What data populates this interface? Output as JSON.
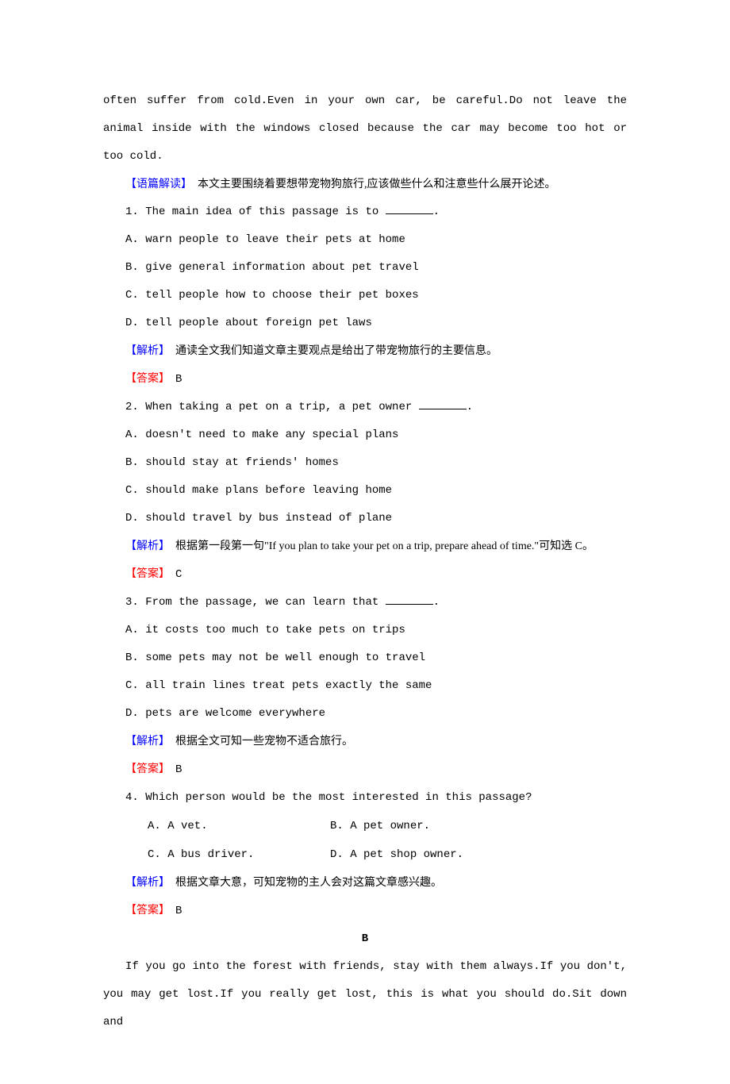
{
  "p1": "often suffer from cold.Even in your own car, be careful.Do not leave the animal inside with the windows closed because the car may become too hot or too cold.",
  "langHead": {
    "label": "【语篇解读】",
    "text": "　本文主要围绕着要想带宠物狗旅行,应该做些什么和注意些什么展开论述。"
  },
  "q1": {
    "stem": "1. The main idea of this passage is to ",
    "stemEnd": ".",
    "a": "A. warn people to leave their pets at home",
    "b": "B. give general information about pet travel",
    "c": "C. tell people how to choose their pet boxes",
    "d": "D. tell people about foreign pet laws",
    "expLabel": "【解析】",
    "expText": "　通读全文我们知道文章主要观点是给出了带宠物旅行的主要信息。",
    "ansLabel": "【答案】",
    "ansText": "　B"
  },
  "q2": {
    "stem": "2. When taking a pet on a trip, a pet owner ",
    "stemEnd": ".",
    "a": "A. doesn't need to make any special plans",
    "b": "B. should stay at friends' homes",
    "c": "C. should make plans before leaving home",
    "d": "D. should travel by bus instead of plane",
    "expLabel": "【解析】",
    "expText": "　根据第一段第一句\"If you plan to take your pet on a trip, prepare ahead of time.\"可知选 C。",
    "ansLabel": "【答案】",
    "ansText": "　C"
  },
  "q3": {
    "stem": "3. From the passage, we can learn that ",
    "stemEnd": ".",
    "a": "A. it costs too much to take pets on trips",
    "b": "B. some pets may not be well enough to travel",
    "c": "C. all train lines treat pets exactly the same",
    "d": "D. pets are welcome everywhere",
    "expLabel": "【解析】",
    "expText": "　根据全文可知一些宠物不适合旅行。",
    "ansLabel": "【答案】",
    "ansText": "　B"
  },
  "q4": {
    "stem": "4. Which person would be the most interested in this passage?",
    "a": "A. A vet.",
    "b": "B. A pet owner.",
    "c": "C. A bus driver.",
    "d": "D. A pet shop owner.",
    "expLabel": "【解析】",
    "expText": "　根据文章大意，可知宠物的主人会对这篇文章感兴趣。",
    "ansLabel": "【答案】",
    "ansText": "　B"
  },
  "sectionB": "B",
  "pB": "If you go into the forest with friends, stay with them always.If you don't, you may get lost.If you really get lost, this is what you should do.Sit down and"
}
